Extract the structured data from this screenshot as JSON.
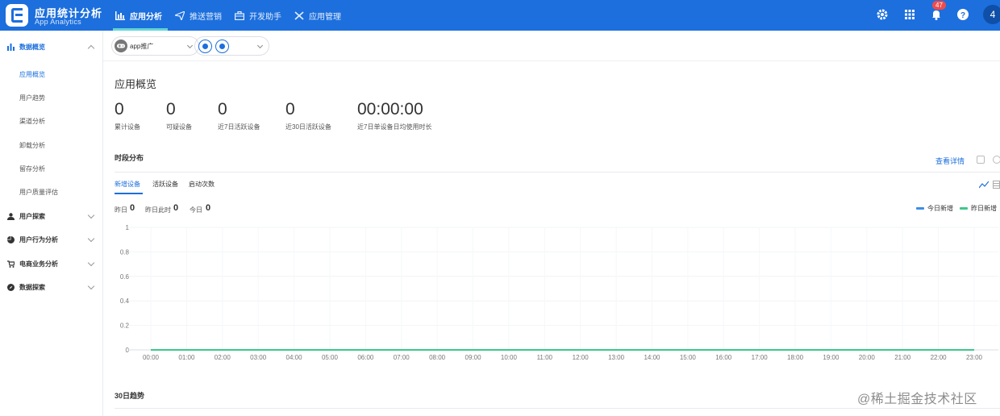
{
  "header": {
    "app_title": "应用统计分析",
    "app_subtitle": "App Analytics",
    "nav": [
      {
        "label": "应用分析",
        "icon": "bar-chart-icon"
      },
      {
        "label": "推送营销",
        "icon": "paper-plane-icon"
      },
      {
        "label": "开发助手",
        "icon": "toolbox-icon"
      },
      {
        "label": "应用管理",
        "icon": "wrench-icon"
      }
    ],
    "notification_count": "47",
    "avatar_text": "4"
  },
  "sidebar": {
    "groups": [
      {
        "label": "数据概览",
        "icon": "bar-chart-icon",
        "expanded": true
      },
      {
        "label": "用户探索",
        "icon": "user-icon"
      },
      {
        "label": "用户行为分析",
        "icon": "pie-chart-icon"
      },
      {
        "label": "电商业务分析",
        "icon": "cart-icon"
      },
      {
        "label": "数据探索",
        "icon": "compass-icon"
      }
    ],
    "items": [
      "应用概览",
      "用户趋势",
      "渠道分析",
      "卸载分析",
      "留存分析",
      "用户质量评估"
    ]
  },
  "selector": {
    "app_name": "app推广"
  },
  "overview": {
    "title": "应用概览",
    "kpis": [
      {
        "value": "0",
        "label": "累计设备"
      },
      {
        "value": "0",
        "label": "可疑设备"
      },
      {
        "value": "0",
        "label": "近7日活跃设备"
      },
      {
        "value": "0",
        "label": "近30日活跃设备"
      },
      {
        "value": "00:00:00",
        "label": "近7日单设备日均使用时长"
      }
    ]
  },
  "time_dist": {
    "title": "时段分布",
    "detail_link": "查看详情",
    "tabs": [
      "新增设备",
      "活跃设备",
      "启动次数"
    ],
    "stats": [
      {
        "label": "昨日",
        "value": "0"
      },
      {
        "label": "昨日此时",
        "value": "0"
      },
      {
        "label": "今日",
        "value": "0"
      }
    ]
  },
  "chart_data": {
    "type": "line",
    "x": [
      "00:00",
      "01:00",
      "02:00",
      "03:00",
      "04:00",
      "05:00",
      "06:00",
      "07:00",
      "08:00",
      "09:00",
      "10:00",
      "11:00",
      "12:00",
      "13:00",
      "14:00",
      "15:00",
      "16:00",
      "17:00",
      "18:00",
      "19:00",
      "20:00",
      "21:00",
      "22:00",
      "23:00"
    ],
    "y_ticks": [
      "1",
      "0.8",
      "0.6",
      "0.4",
      "0.2",
      "0"
    ],
    "ylim": [
      0,
      1
    ],
    "grid": true,
    "legend_position": "top-right",
    "series": [
      {
        "name": "今日新增",
        "color": "#3a8ee6",
        "values": [
          0,
          0,
          0,
          0,
          0,
          0,
          0,
          0,
          0,
          0,
          0,
          0,
          0,
          0,
          0,
          0,
          0,
          0,
          0,
          0,
          0,
          0,
          0,
          0
        ]
      },
      {
        "name": "昨日新增",
        "color": "#3cc88a",
        "values": [
          0,
          0,
          0,
          0,
          0,
          0,
          0,
          0,
          0,
          0,
          0,
          0,
          0,
          0,
          0,
          0,
          0,
          0,
          0,
          0,
          0,
          0,
          0,
          0
        ]
      }
    ]
  },
  "trend": {
    "title": "30日趋势"
  },
  "watermark": "@稀土掘金技术社区"
}
